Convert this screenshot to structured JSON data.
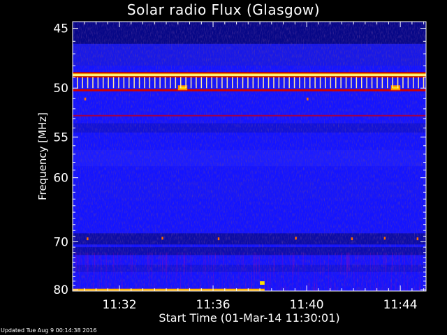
{
  "chart_data": {
    "type": "heatmap",
    "title": "Solar radio Flux (Glasgow)",
    "xlabel": "Start Time (01-Mar-14 11:30:01)",
    "ylabel": "Frequency [MHz]",
    "x_ticks": [
      {
        "label": "11:32",
        "minutes": 2.0
      },
      {
        "label": "11:36",
        "minutes": 6.0
      },
      {
        "label": "11:40",
        "minutes": 10.0
      },
      {
        "label": "11:44",
        "minutes": 14.0
      }
    ],
    "x_range_minutes": [
      0,
      15.1
    ],
    "y_ticks": [
      45,
      50,
      55,
      60,
      70,
      80
    ],
    "y_range_mhz": [
      44.5,
      80.3
    ],
    "y_scale": "reciprocal",
    "features": [
      {
        "kind": "persistent emission line",
        "frequency_mhz": 48.8,
        "intensity": "saturated"
      },
      {
        "kind": "emission line",
        "frequency_mhz": 50.2,
        "intensity": "strong"
      },
      {
        "kind": "emission line",
        "frequency_mhz": 52.7,
        "intensity": "weak"
      },
      {
        "kind": "emission line",
        "frequency_mhz": 80.0,
        "intensity": "strong",
        "time_minutes": [
          0,
          8.2
        ]
      },
      {
        "kind": "burst",
        "frequency_mhz": 50.0,
        "time_minutes": [
          4.5,
          4.9
        ]
      },
      {
        "kind": "burst",
        "frequency_mhz": 50.0,
        "time_minutes": [
          13.6,
          14.0
        ]
      },
      {
        "kind": "spot",
        "frequency_mhz": 78.5,
        "time_minutes": [
          8.0,
          8.2
        ]
      }
    ],
    "colors": {
      "background": "#1414ff",
      "dark_band": "#05057a",
      "red": "#c00000",
      "yellow": "#ffe000"
    }
  },
  "updated": "Updated Tue Aug  9 00:14:38 2016"
}
